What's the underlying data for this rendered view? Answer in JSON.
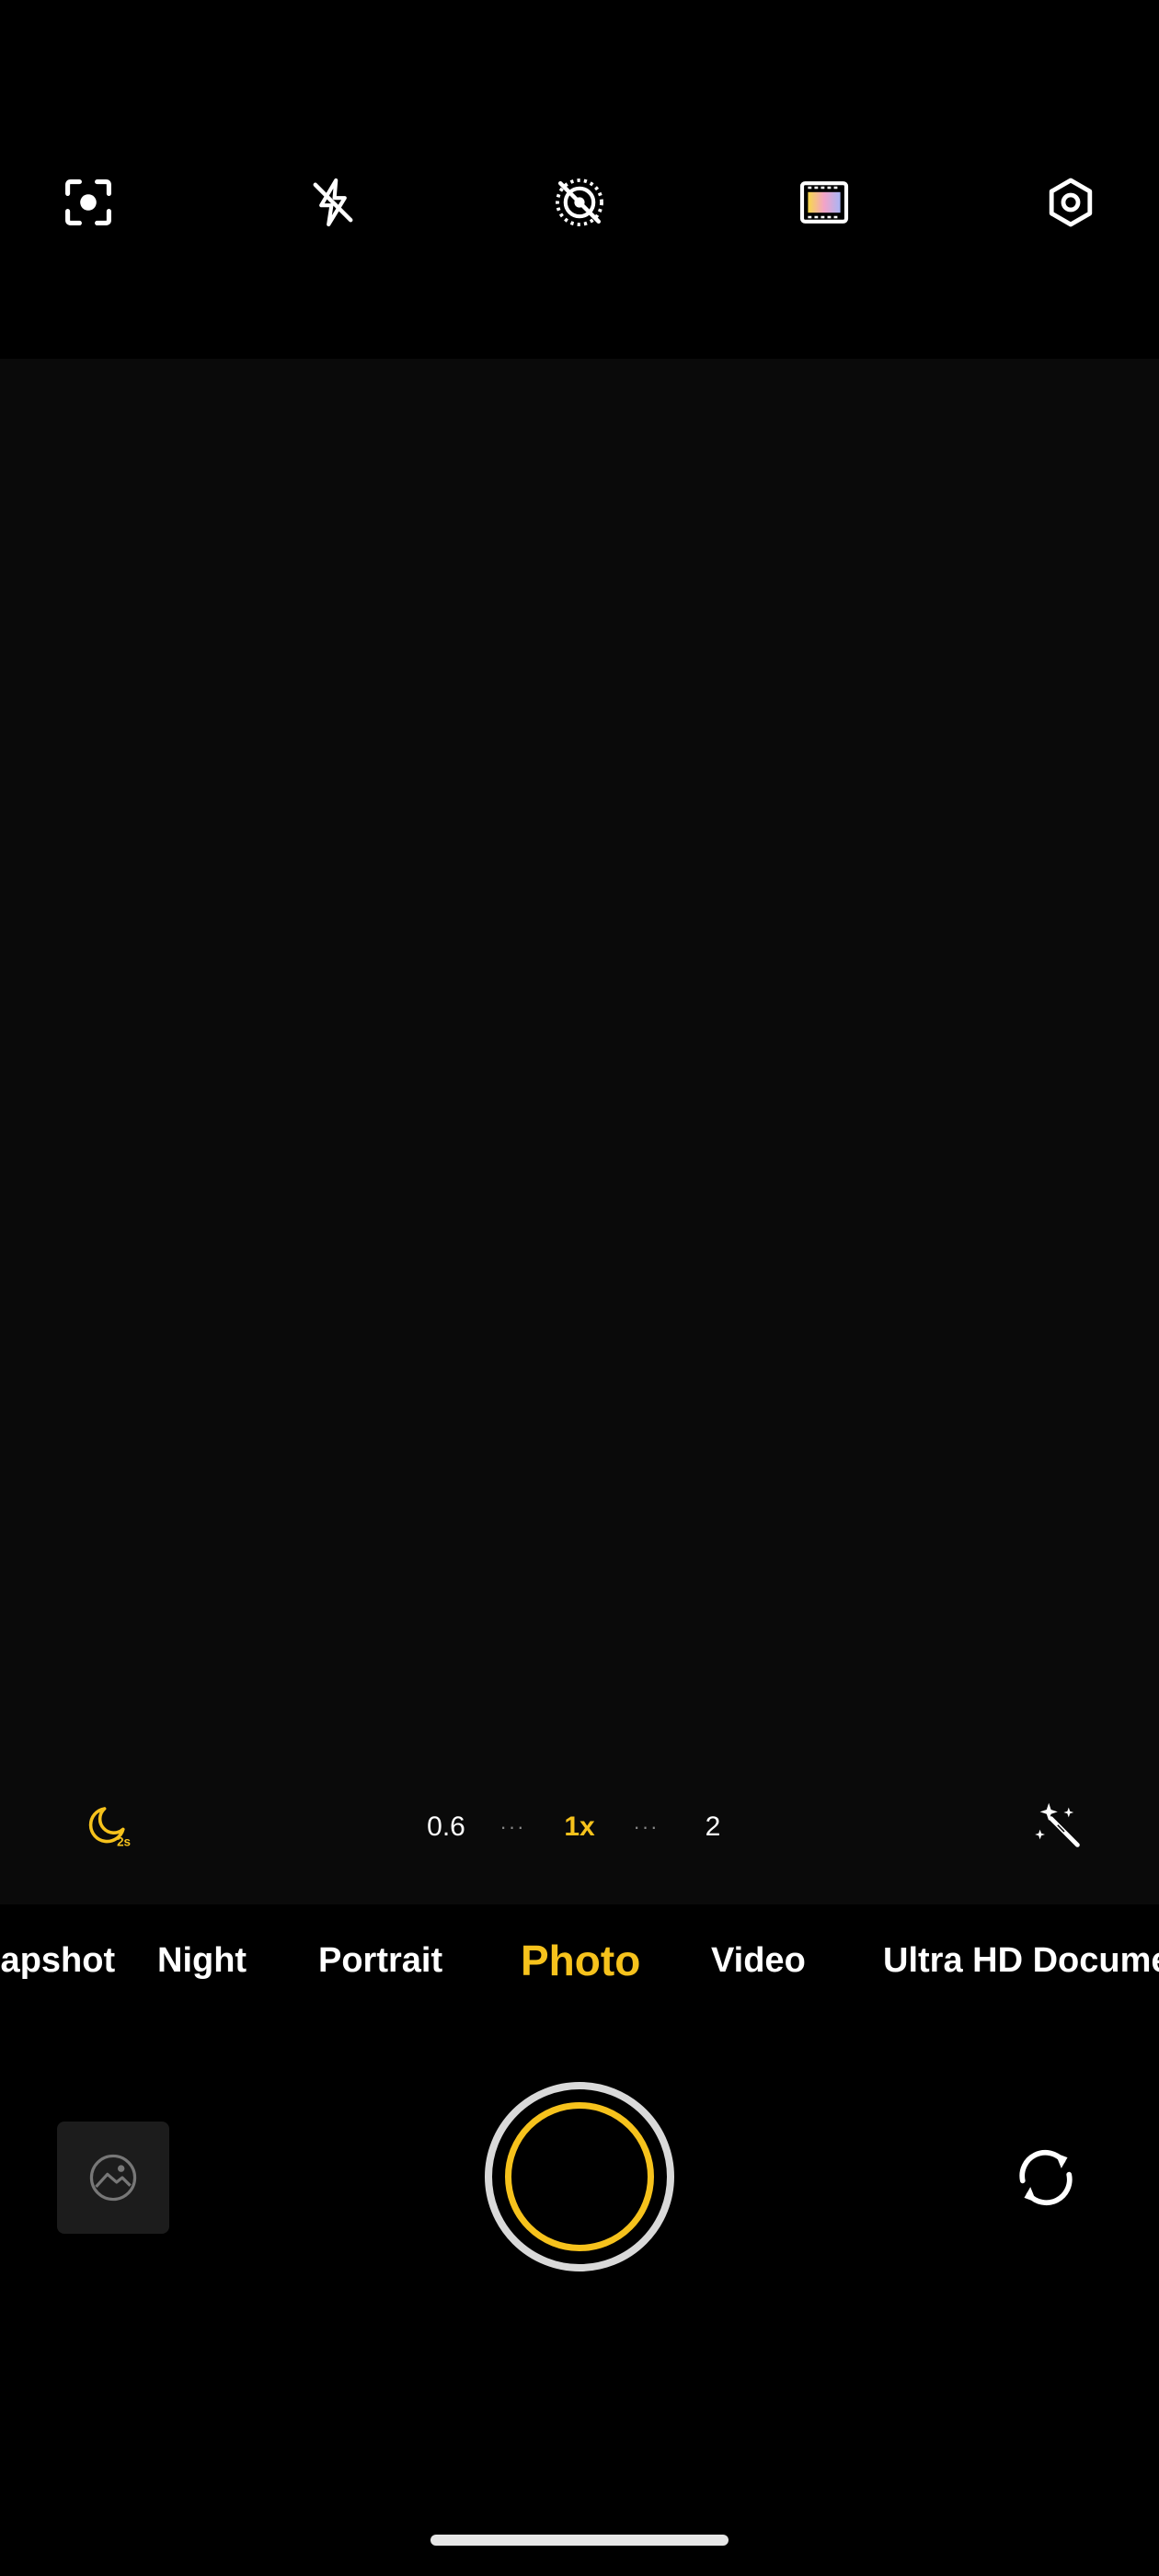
{
  "top_bar": {
    "icons": [
      "focus-scan-icon",
      "flash-off-icon",
      "live-photo-off-icon",
      "color-filter-icon",
      "settings-icon"
    ]
  },
  "controls": {
    "night_badge": "2s",
    "zoom": [
      "0.6",
      "1x",
      "2"
    ],
    "zoom_dots": "···",
    "active_zoom": "1x"
  },
  "modes": {
    "items": [
      "Snapshot",
      "Night",
      "Portrait",
      "Photo",
      "Video",
      "Ultra HD Document"
    ],
    "active": "Photo"
  },
  "colors": {
    "accent": "#f6c21c",
    "background": "#000000"
  }
}
